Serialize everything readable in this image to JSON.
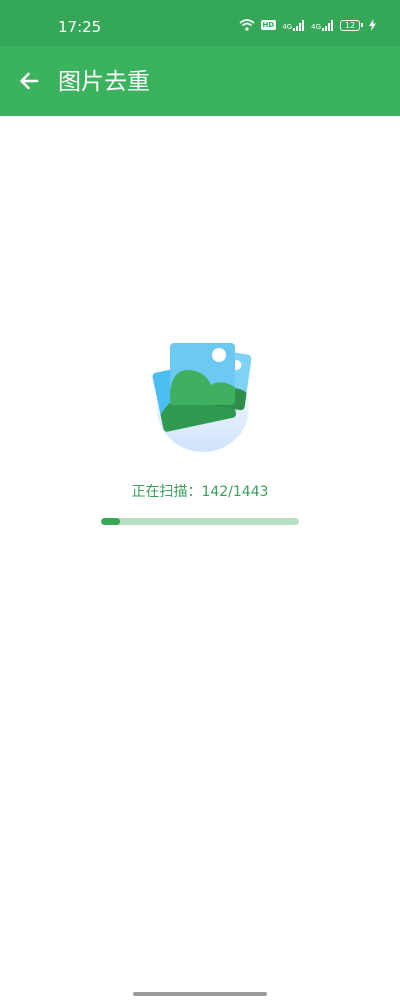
{
  "status_bar": {
    "time": "17:25",
    "icons": [
      "wifi-icon",
      "hd-icon",
      "signal-4g-icon",
      "signal-4g-icon",
      "battery-icon",
      "charging-icon"
    ],
    "hd_label": "HD",
    "network_label_1": "4G",
    "network_label_2": "4G",
    "battery_level": "12"
  },
  "app_bar": {
    "back_icon": "arrow-left-icon",
    "title": "图片去重"
  },
  "scan": {
    "status_text": "正在扫描：142/1443",
    "scanned": 142,
    "total": 1443,
    "progress_fraction": 0.098
  },
  "colors": {
    "status_bar": "#35a857",
    "app_bar": "#3bb25d",
    "accent": "#36a856",
    "progress_track": "#b9e0c5",
    "scan_text": "#3aa05a"
  }
}
